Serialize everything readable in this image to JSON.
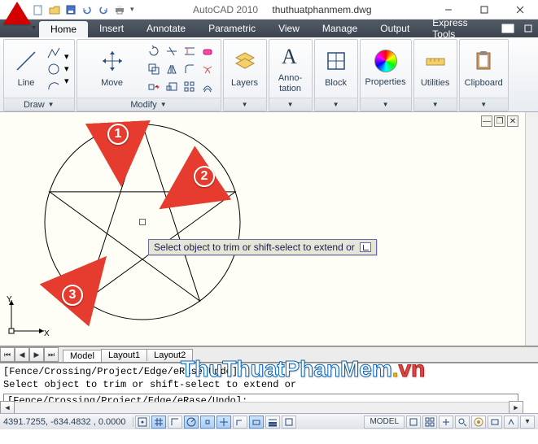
{
  "title": {
    "app": "AutoCAD 2010",
    "file": "thuthuatphanmem.dwg"
  },
  "tabs": [
    "Home",
    "Insert",
    "Annotate",
    "Parametric",
    "View",
    "Manage",
    "Output",
    "Express Tools"
  ],
  "activeTab": "Home",
  "panels": {
    "draw": {
      "title": "Draw",
      "label": "Line"
    },
    "modify": {
      "title": "Modify",
      "label": "Move"
    },
    "layers": {
      "title": "",
      "label": "Layers"
    },
    "anno": {
      "title": "",
      "label1": "Anno-",
      "label2": "tation"
    },
    "block": {
      "title": "",
      "label": "Block"
    },
    "props": {
      "title": "",
      "label": "Properties"
    },
    "utils": {
      "title": "",
      "label": "Utilities"
    },
    "clip": {
      "title": "",
      "label": "Clipboard"
    }
  },
  "drawing": {
    "tooltip": "Select object to trim or shift-select to extend or",
    "callouts": [
      "1",
      "2",
      "3"
    ],
    "ucs_y": "Y",
    "ucs_x": "X"
  },
  "layoutTabs": [
    "Model",
    "Layout1",
    "Layout2"
  ],
  "command": {
    "history1": "[Fence/Crossing/Project/Edge/eRase/Undo]:",
    "history2": "Select object to trim or shift-select to extend or",
    "prompt": "[Fence/Crossing/Project/Edge/eRase/Undo]:"
  },
  "status": {
    "coord": "4391.7255, -634.4832 , 0.0000",
    "model": "MODEL"
  },
  "watermark": {
    "t1": "ThuThuatPhanMem",
    "dot": ".",
    "t2": "vn"
  }
}
